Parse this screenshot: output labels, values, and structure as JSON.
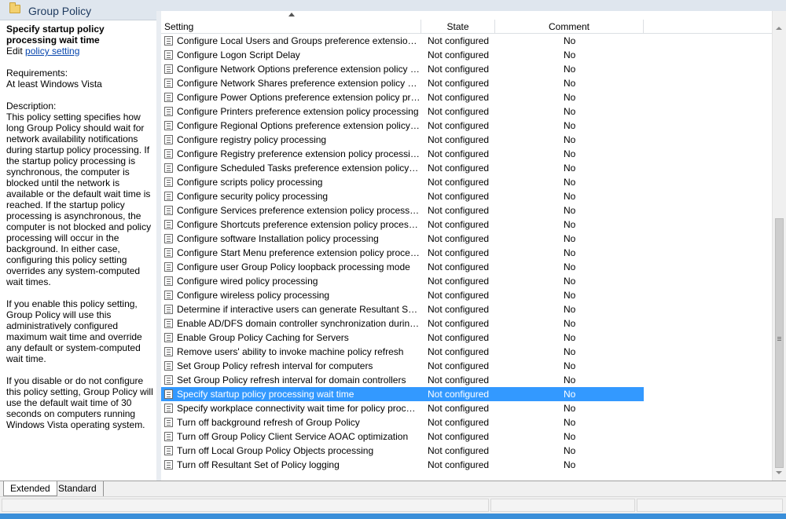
{
  "window": {
    "title": "Group Policy"
  },
  "description": {
    "title": "Specify startup policy processing wait time",
    "edit_prefix": "Edit ",
    "edit_link": "policy setting ",
    "requirements_label": "Requirements:",
    "requirements_value": "At least Windows Vista",
    "description_label": "Description:",
    "para1": "This policy setting specifies how long Group Policy should wait for network availability notifications during startup policy processing. If the startup policy processing is synchronous, the computer is blocked until the network is available or the default wait time is reached. If the startup policy processing is asynchronous, the computer is not blocked and policy processing will occur in the background. In either case, configuring this policy setting overrides any system-computed wait times.",
    "para2": "If you enable this policy setting, Group Policy will use this administratively configured maximum wait time and override any default or system-computed wait time.",
    "para3": "If you disable or do not configure this policy setting, Group Policy will use the default wait time of 30 seconds on computers running Windows Vista operating system."
  },
  "columns": {
    "setting": "Setting",
    "state": "State",
    "comment": "Comment"
  },
  "rows": [
    {
      "name": "Configure Local Users and Groups preference extension poli...",
      "state": "Not configured",
      "comment": "No"
    },
    {
      "name": "Configure Logon Script Delay",
      "state": "Not configured",
      "comment": "No"
    },
    {
      "name": "Configure Network Options preference extension policy pro...",
      "state": "Not configured",
      "comment": "No"
    },
    {
      "name": "Configure Network Shares preference extension policy proc...",
      "state": "Not configured",
      "comment": "No"
    },
    {
      "name": "Configure Power Options preference extension policy proce...",
      "state": "Not configured",
      "comment": "No"
    },
    {
      "name": "Configure Printers preference extension policy processing",
      "state": "Not configured",
      "comment": "No"
    },
    {
      "name": "Configure Regional Options preference extension policy pro...",
      "state": "Not configured",
      "comment": "No"
    },
    {
      "name": "Configure registry policy processing",
      "state": "Not configured",
      "comment": "No"
    },
    {
      "name": "Configure Registry preference extension policy processing",
      "state": "Not configured",
      "comment": "No"
    },
    {
      "name": "Configure Scheduled Tasks preference extension policy proc...",
      "state": "Not configured",
      "comment": "No"
    },
    {
      "name": "Configure scripts policy processing",
      "state": "Not configured",
      "comment": "No"
    },
    {
      "name": "Configure security policy processing",
      "state": "Not configured",
      "comment": "No"
    },
    {
      "name": "Configure Services preference extension policy processing",
      "state": "Not configured",
      "comment": "No"
    },
    {
      "name": "Configure Shortcuts preference extension policy processing",
      "state": "Not configured",
      "comment": "No"
    },
    {
      "name": "Configure software Installation policy processing",
      "state": "Not configured",
      "comment": "No"
    },
    {
      "name": "Configure Start Menu preference extension policy processing",
      "state": "Not configured",
      "comment": "No"
    },
    {
      "name": "Configure user Group Policy loopback processing mode",
      "state": "Not configured",
      "comment": "No"
    },
    {
      "name": "Configure wired policy processing",
      "state": "Not configured",
      "comment": "No"
    },
    {
      "name": "Configure wireless policy processing",
      "state": "Not configured",
      "comment": "No"
    },
    {
      "name": "Determine if interactive users can generate Resultant Set of ...",
      "state": "Not configured",
      "comment": "No"
    },
    {
      "name": "Enable AD/DFS domain controller synchronization during p...",
      "state": "Not configured",
      "comment": "No"
    },
    {
      "name": "Enable Group Policy Caching for Servers",
      "state": "Not configured",
      "comment": "No"
    },
    {
      "name": "Remove users' ability to invoke machine policy refresh",
      "state": "Not configured",
      "comment": "No"
    },
    {
      "name": "Set Group Policy refresh interval for computers",
      "state": "Not configured",
      "comment": "No"
    },
    {
      "name": "Set Group Policy refresh interval for domain controllers",
      "state": "Not configured",
      "comment": "No"
    },
    {
      "name": "Specify startup policy processing wait time",
      "state": "Not configured",
      "comment": "No",
      "selected": true
    },
    {
      "name": "Specify workplace connectivity wait time for policy processi...",
      "state": "Not configured",
      "comment": "No"
    },
    {
      "name": "Turn off background refresh of Group Policy",
      "state": "Not configured",
      "comment": "No"
    },
    {
      "name": "Turn off Group Policy Client Service AOAC optimization",
      "state": "Not configured",
      "comment": "No"
    },
    {
      "name": "Turn off Local Group Policy Objects processing",
      "state": "Not configured",
      "comment": "No"
    },
    {
      "name": "Turn off Resultant Set of Policy logging",
      "state": "Not configured",
      "comment": "No"
    }
  ],
  "tabs": {
    "extended": "Extended",
    "standard": "Standard"
  },
  "colors": {
    "selection": "#3399ff",
    "link": "#0645ad",
    "title_bar": "#dfe6ee"
  }
}
